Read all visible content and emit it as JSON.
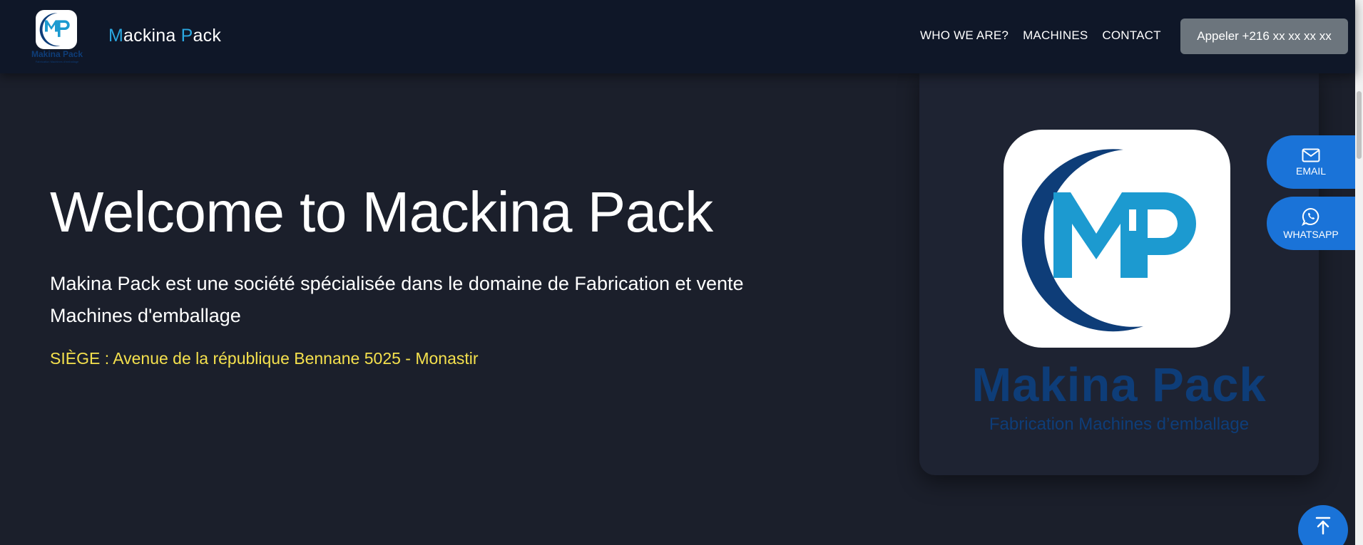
{
  "header": {
    "logo_text": "Makina Pack",
    "logo_subtext": "Fabrication Machines d'emballage",
    "brand_first_letter": "M",
    "brand_first_rest": "ackina ",
    "brand_second_letter": "P",
    "brand_second_rest": "ack",
    "nav": [
      "WHO WE ARE?",
      "MACHINES",
      "CONTACT"
    ],
    "call_button": "Appeler +216 xx xx xx xx"
  },
  "hero": {
    "title": "Welcome to Mackina Pack",
    "description": "Makina Pack est une société spécialisée dans le domaine de Fabrication et vente Machines d'emballage",
    "address": "SIÈGE : Avenue de la république Bennane 5025 - Monastir"
  },
  "card": {
    "name": "Makina Pack",
    "tagline": "Fabrication Machines d’emballage"
  },
  "floating": {
    "email_label": "EMAIL",
    "whatsapp_label": "WHATSAPP"
  },
  "colors": {
    "background": "#1b1f2b",
    "header": "#0f1728",
    "accent_blue": "#2aa7e0",
    "logo_navy": "#0e3d78",
    "address_yellow": "#f4e04d",
    "float_blue": "#1a73d8",
    "call_button_gray": "#6c757d"
  },
  "icons": [
    "mp-logo-icon",
    "mail-icon",
    "whatsapp-icon",
    "arrow-up-to-top-icon"
  ]
}
